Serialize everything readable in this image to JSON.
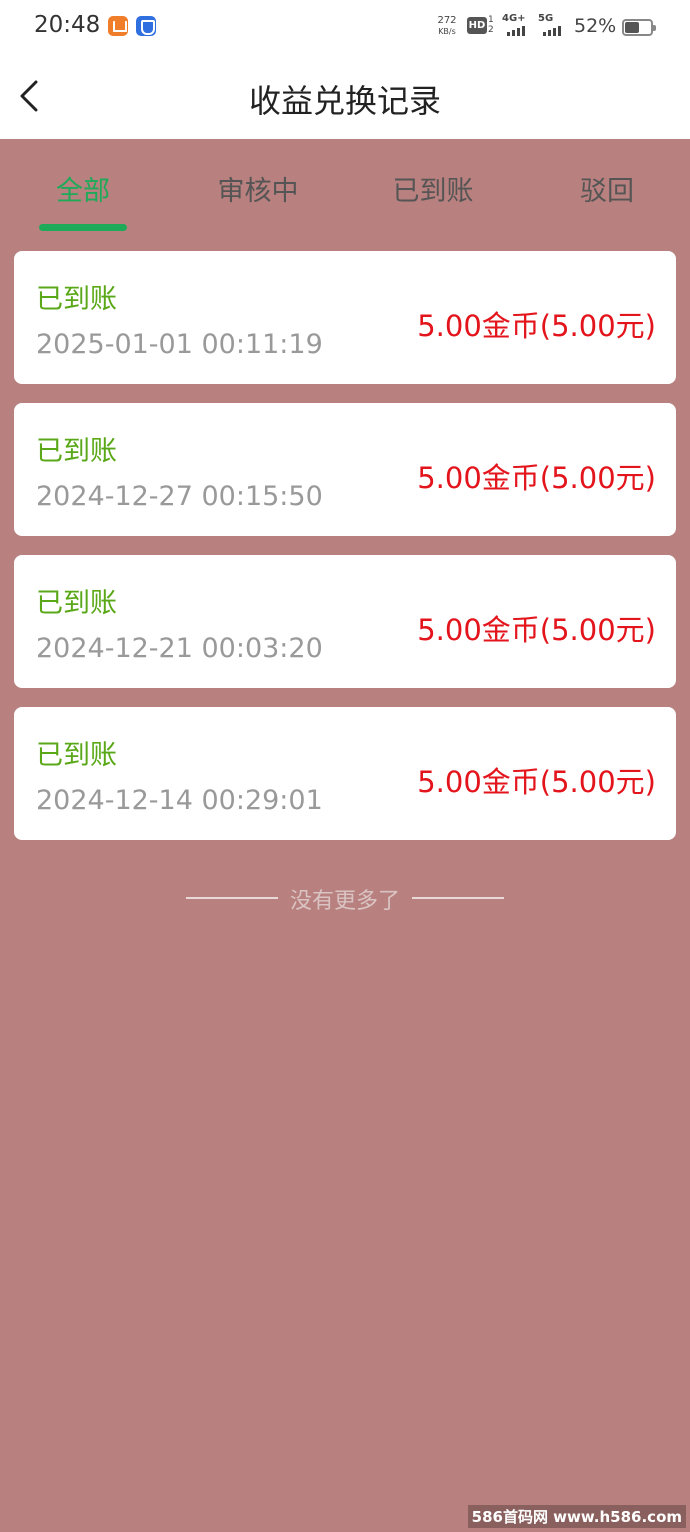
{
  "status_bar": {
    "time": "20:48",
    "net_speed_value": "272",
    "net_speed_unit": "KB/s",
    "hd_label": "HD",
    "hd_sub": "1 2",
    "sim1_tech": "4G+",
    "sim2_tech": "5G",
    "battery_pct": "52%"
  },
  "header": {
    "title": "收益兑换记录"
  },
  "tabs": [
    {
      "label": "全部",
      "active": true
    },
    {
      "label": "审核中",
      "active": false
    },
    {
      "label": "已到账",
      "active": false
    },
    {
      "label": "驳回",
      "active": false
    }
  ],
  "records": [
    {
      "status": "已到账",
      "time": "2025-01-01 00:11:19",
      "amount": "5.00金币(5.00元)"
    },
    {
      "status": "已到账",
      "time": "2024-12-27 00:15:50",
      "amount": "5.00金币(5.00元)"
    },
    {
      "status": "已到账",
      "time": "2024-12-21 00:03:20",
      "amount": "5.00金币(5.00元)"
    },
    {
      "status": "已到账",
      "time": "2024-12-14 00:29:01",
      "amount": "5.00金币(5.00元)"
    }
  ],
  "end_note": "没有更多了",
  "watermark": "586首码网 www.h586.com",
  "colors": {
    "background": "#b8807e",
    "accent_green": "#1faa5a",
    "status_green": "#5aa818",
    "amount_red": "#e3141b"
  }
}
